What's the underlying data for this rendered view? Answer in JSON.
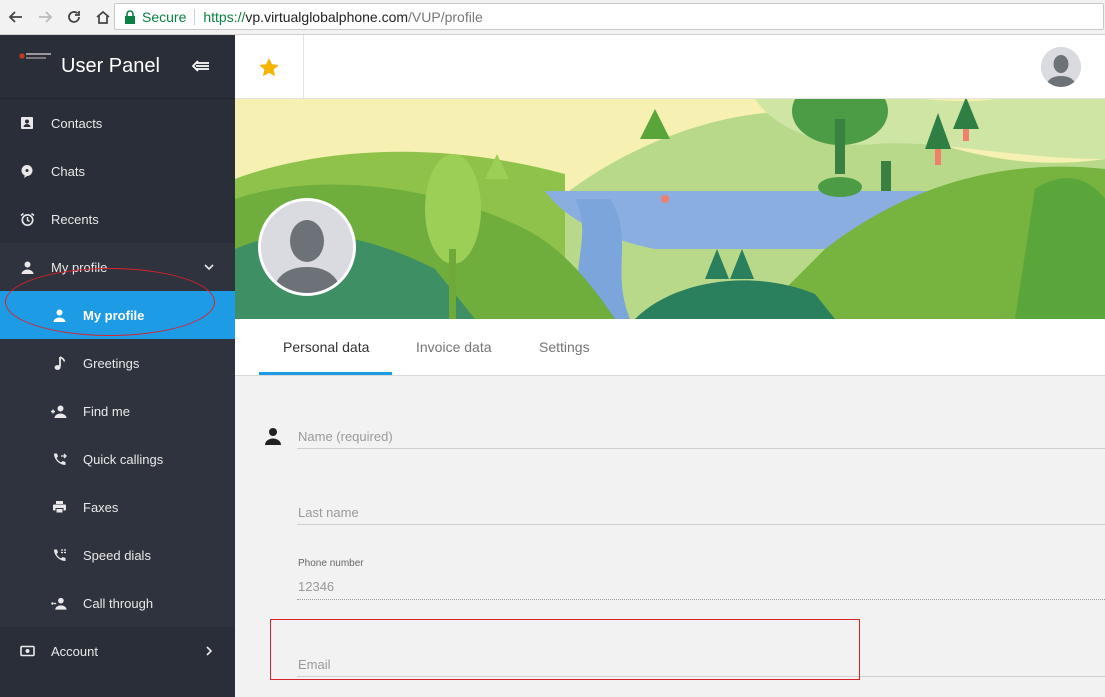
{
  "browser": {
    "secure_label": "Secure",
    "url_scheme": "https://",
    "url_host": "vp.virtualglobalphone.com",
    "url_path": "/VUP/profile"
  },
  "sidebar": {
    "title": "User Panel",
    "items": [
      {
        "label": "Contacts",
        "icon": "contacts-icon"
      },
      {
        "label": "Chats",
        "icon": "chat-icon"
      },
      {
        "label": "Recents",
        "icon": "alarm-clock-icon"
      },
      {
        "label": "My profile",
        "icon": "person-icon"
      }
    ],
    "subitems": [
      {
        "label": "My profile",
        "icon": "person-icon",
        "active": true
      },
      {
        "label": "Greetings",
        "icon": "music-note-icon"
      },
      {
        "label": "Find me",
        "icon": "find-person-icon"
      },
      {
        "label": "Quick callings",
        "icon": "phone-forward-icon"
      },
      {
        "label": "Faxes",
        "icon": "printer-icon"
      },
      {
        "label": "Speed dials",
        "icon": "phone-list-icon"
      },
      {
        "label": "Call through",
        "icon": "call-through-icon"
      }
    ],
    "account": {
      "label": "Account",
      "icon": "account-icon"
    }
  },
  "tabs": [
    {
      "label": "Personal data",
      "active": true
    },
    {
      "label": "Invoice data",
      "active": false
    },
    {
      "label": "Settings",
      "active": false
    }
  ],
  "form": {
    "name_placeholder": "Name (required)",
    "lastname_placeholder": "Last name",
    "phone_label": "Phone number",
    "phone_value": "12346",
    "email_placeholder": "Email"
  },
  "colors": {
    "sidebar_bg": "#2a2e38",
    "active_bg": "#1e9be5",
    "accent": "#1e9be5",
    "star": "#f5b400",
    "annotation": "#d8232a"
  }
}
